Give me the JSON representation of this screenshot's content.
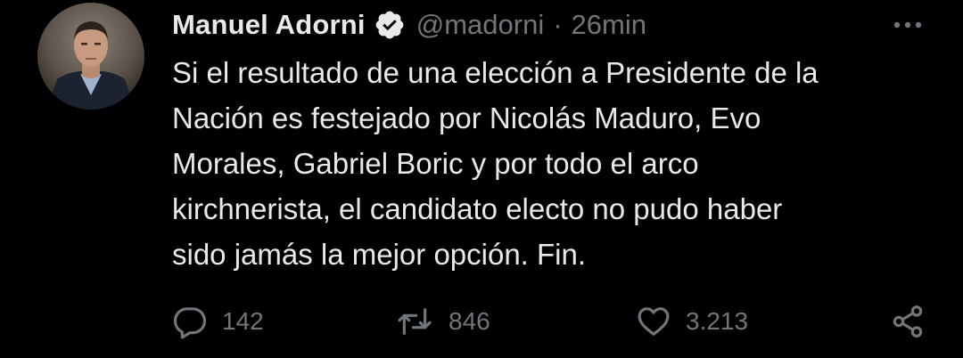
{
  "author": {
    "name": "Manuel Adorni",
    "handle": "@madorni",
    "separator": "·",
    "time": "26min",
    "verified": true
  },
  "tweet": {
    "text": "Si el resultado de una elección a Presidente de la\nNación es festejado por Nicolás Maduro, Evo\nMorales, Gabriel Boric y por todo el arco\nkirchnerista, el candidato electo no pudo haber\nsido jamás la mejor opción. Fin."
  },
  "actions": {
    "replies": "142",
    "retweets": "846",
    "likes": "3.213"
  },
  "icons": {
    "verified": "verified-badge-icon",
    "more": "more-options-icon",
    "reply": "reply-icon",
    "retweet": "retweet-icon",
    "like": "heart-icon",
    "share": "share-icon"
  },
  "colors": {
    "background": "#000000",
    "primary_text": "#e7e9ea",
    "secondary_text": "#71767b"
  }
}
